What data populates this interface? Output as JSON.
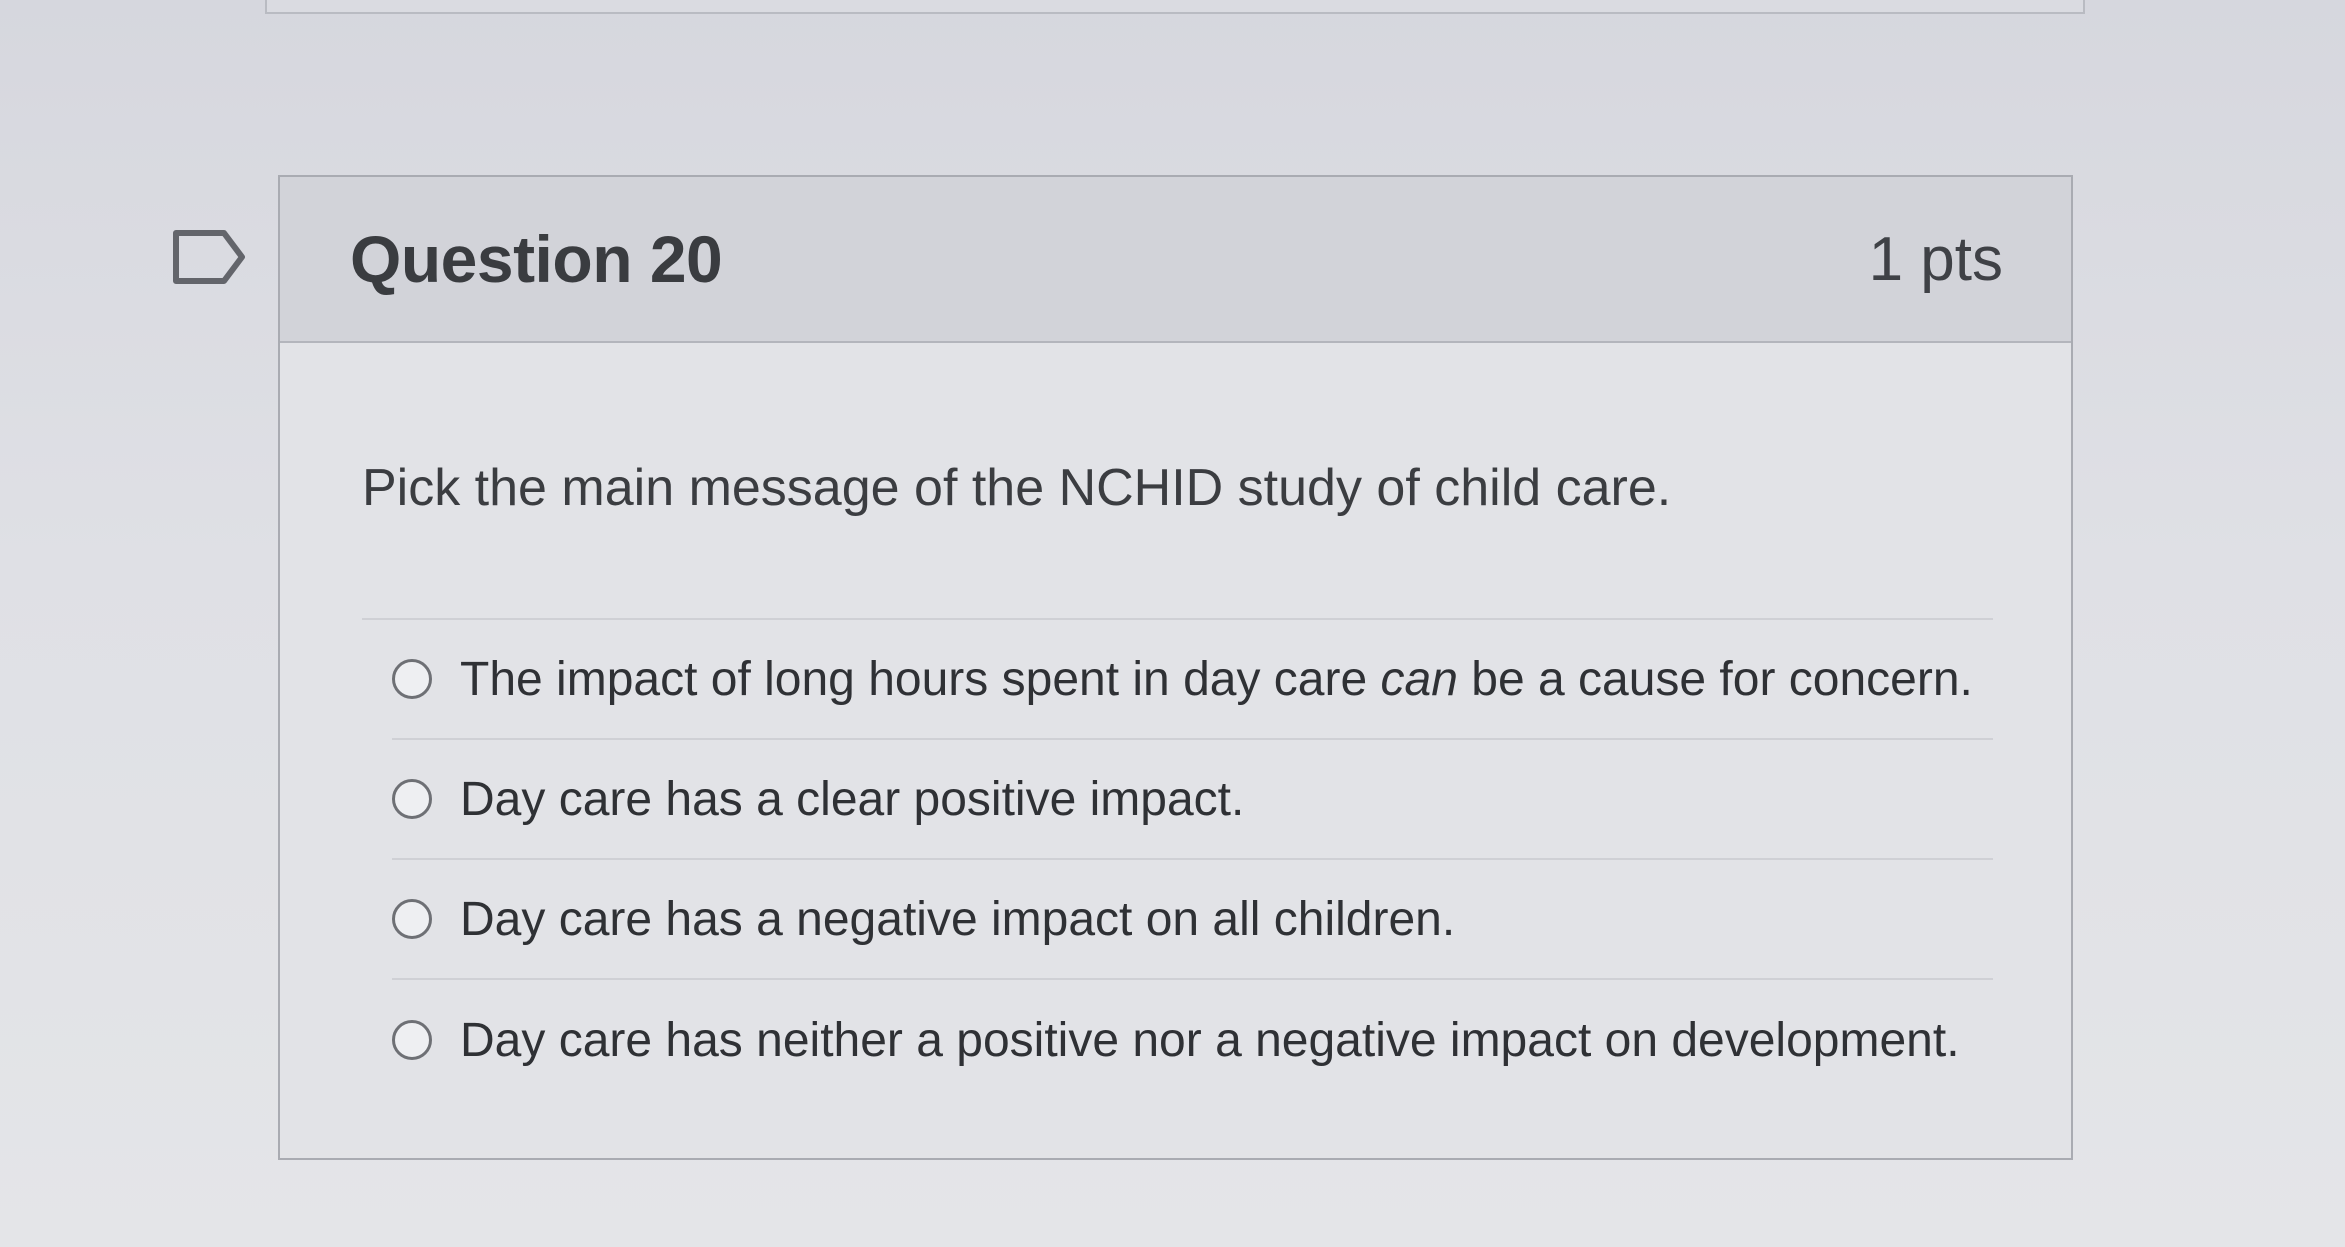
{
  "question": {
    "title": "Question 20",
    "points": "1 pts",
    "text": "Pick the main message of the NCHID study of child care.",
    "flag_icon": "flag-outline-icon"
  },
  "answers": [
    {
      "label_before": "The impact of long hours spent in day care ",
      "label_emphasis": "can",
      "label_after": " be a cause for concern.",
      "selected": false
    },
    {
      "label": "Day care has a clear positive impact.",
      "selected": false
    },
    {
      "label": "Day care has a negative impact on all children.",
      "selected": false
    },
    {
      "label": "Day care has neither a positive nor a negative impact on development.",
      "selected": false
    }
  ],
  "colors": {
    "background": "#dcdde2",
    "header_background": "#d2d3d9",
    "border": "#a9abb2",
    "text": "#3a3c40"
  }
}
